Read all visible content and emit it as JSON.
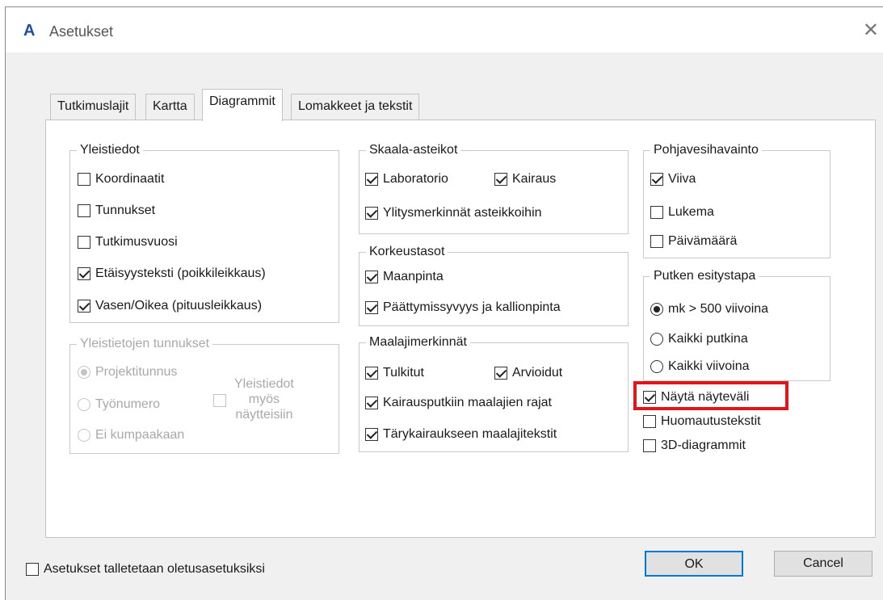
{
  "window": {
    "title": "Asetukset",
    "app_icon": "A",
    "close_glyph": "✕"
  },
  "tabs": [
    "Tutkimuslajit",
    "Kartta",
    "Diagrammit",
    "Lomakkeet ja tekstit"
  ],
  "active_tab": "Diagrammit",
  "groups": {
    "yleistiedot": {
      "legend": "Yleistiedot",
      "items": [
        {
          "label": "Koordinaatit",
          "checked": false
        },
        {
          "label": "Tunnukset",
          "checked": false
        },
        {
          "label": "Tutkimusvuosi",
          "checked": false
        },
        {
          "label": "Etäisyysteksti (poikkileikkaus)",
          "checked": true
        },
        {
          "label": "Vasen/Oikea (pituusleikkaus)",
          "checked": true
        }
      ]
    },
    "yleistietojen_tunnukset": {
      "legend": "Yleistietojen tunnukset",
      "radios": [
        {
          "label": "Projektitunnus",
          "checked": true
        },
        {
          "label": "Työnumero",
          "checked": false
        },
        {
          "label": "Ei kumpaakaan",
          "checked": false
        }
      ],
      "checkbox_lines": [
        "Yleistiedot",
        "myös",
        "näytteisiin"
      ]
    },
    "skaala": {
      "legend": "Skaala-asteikot",
      "items": [
        {
          "label": "Laboratorio",
          "checked": true
        },
        {
          "label": "Kairaus",
          "checked": true
        },
        {
          "label": "Ylitysmerkinnät asteikkoihin",
          "checked": true
        }
      ]
    },
    "korkeustasot": {
      "legend": "Korkeustasot",
      "items": [
        {
          "label": "Maanpinta",
          "checked": true
        },
        {
          "label": "Päättymissyvyys ja kallionpinta",
          "checked": true
        }
      ]
    },
    "maalajimerkinnat": {
      "legend": "Maalajimerkinnät",
      "items": [
        {
          "label": "Tulkitut",
          "checked": true
        },
        {
          "label": "Arvioidut",
          "checked": true
        },
        {
          "label": "Kairausputkiin maalajien rajat",
          "checked": true
        },
        {
          "label": "Tärykairaukseen maalajitekstit",
          "checked": true
        }
      ]
    },
    "pohjavesi": {
      "legend": "Pohjavesihavainto",
      "items": [
        {
          "label": "Viiva",
          "checked": true
        },
        {
          "label": "Lukema",
          "checked": false
        },
        {
          "label": "Päivämäärä",
          "checked": false
        }
      ]
    },
    "putken": {
      "legend": "Putken esitystapa",
      "radios": [
        {
          "label": "mk > 500 viivoina",
          "checked": true
        },
        {
          "label": "Kaikki putkina",
          "checked": false
        },
        {
          "label": "Kaikki viivoina",
          "checked": false
        }
      ]
    }
  },
  "loose_items": [
    {
      "label": "Näytä näyteväli",
      "checked": true
    },
    {
      "label": "Huomautustekstit",
      "checked": false
    },
    {
      "label": "3D-diagrammit",
      "checked": false
    }
  ],
  "footer": {
    "save_defaults_label": "Asetukset talletetaan oletusasetuksiksi",
    "save_defaults_checked": false,
    "ok_label": "OK",
    "cancel_label": "Cancel"
  },
  "colors": {
    "highlight": "#e0161b",
    "accent": "#0078d7"
  }
}
